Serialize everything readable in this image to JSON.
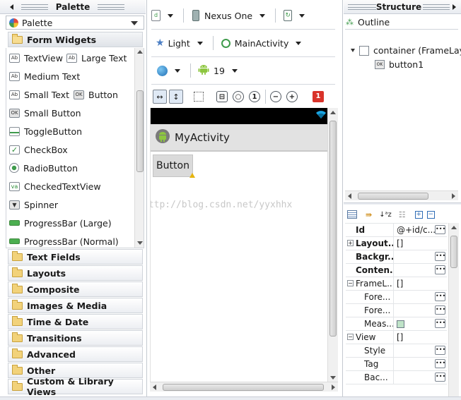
{
  "palette": {
    "title": "Palette",
    "selector_label": "Palette",
    "form_widgets_label": "Form Widgets",
    "widgets": [
      {
        "label": "TextView",
        "icon": "Ab"
      },
      {
        "label": "Large Text",
        "icon": "Ab"
      },
      {
        "label": "Medium Text",
        "icon": "Ab"
      },
      {
        "label": "Small Text",
        "icon": "Ab"
      },
      {
        "label": "Button",
        "icon": "OK"
      },
      {
        "label": "Small Button",
        "icon": "OK"
      },
      {
        "label": "ToggleButton",
        "icon": "toggle-icon"
      },
      {
        "label": "CheckBox",
        "icon": "checkbox-icon"
      },
      {
        "label": "RadioButton",
        "icon": "radio-icon"
      },
      {
        "label": "CheckedTextView",
        "icon": "checked-text-icon"
      },
      {
        "label": "Spinner",
        "icon": "spinner-icon"
      },
      {
        "label": "ProgressBar (Large)",
        "icon": "progress-icon"
      },
      {
        "label": "ProgressBar (Normal)",
        "icon": "progress-icon"
      }
    ],
    "categories": [
      "Text Fields",
      "Layouts",
      "Composite",
      "Images & Media",
      "Time & Date",
      "Transitions",
      "Advanced",
      "Other",
      "Custom & Library Views"
    ]
  },
  "toolbar": {
    "device": "Nexus One",
    "theme": "Light",
    "activity": "MainActivity",
    "api_level": "19",
    "error_count": "1"
  },
  "canvas": {
    "app_title": "MyActivity",
    "button_label": "Button",
    "watermark": "http://blog.csdn.net/yyxhhx"
  },
  "structure": {
    "title": "Structure",
    "outline_label": "Outline",
    "tree": [
      {
        "label": "container (FrameLay"
      },
      {
        "label": "button1"
      }
    ]
  },
  "properties": {
    "rows": [
      {
        "name": "Id",
        "value": "@+id/c...",
        "bold": true,
        "expander": "",
        "dots": true
      },
      {
        "name": "Layout...",
        "value": "[]",
        "bold": true,
        "expander": "+",
        "dots": false
      },
      {
        "name": "Backgr...",
        "value": "",
        "bold": true,
        "expander": "",
        "dots": true
      },
      {
        "name": "Conten...",
        "value": "",
        "bold": true,
        "expander": "",
        "dots": true
      },
      {
        "name": "FrameL...",
        "value": "[]",
        "bold": false,
        "expander": "−",
        "dots": false
      },
      {
        "name": "Fore...",
        "value": "",
        "bold": false,
        "expander": "",
        "dots": true
      },
      {
        "name": "Fore...",
        "value": "",
        "bold": false,
        "expander": "",
        "dots": true
      },
      {
        "name": "Meas...",
        "value": "",
        "bold": false,
        "expander": "",
        "dots": true
      },
      {
        "name": "View",
        "value": "[]",
        "bold": false,
        "expander": "−",
        "dots": false
      },
      {
        "name": "Style",
        "value": "",
        "bold": false,
        "expander": "",
        "dots": true
      },
      {
        "name": "Tag",
        "value": "",
        "bold": false,
        "expander": "",
        "dots": true
      },
      {
        "name": "Bac...",
        "value": "",
        "bold": false,
        "expander": "",
        "dots": true
      }
    ]
  },
  "colors": {
    "accent_blue": "#3a7bd5",
    "error_red": "#d9332a",
    "android_green": "#8dc63f",
    "status_bar": "#000000",
    "action_bar": "#e2e2e2"
  }
}
